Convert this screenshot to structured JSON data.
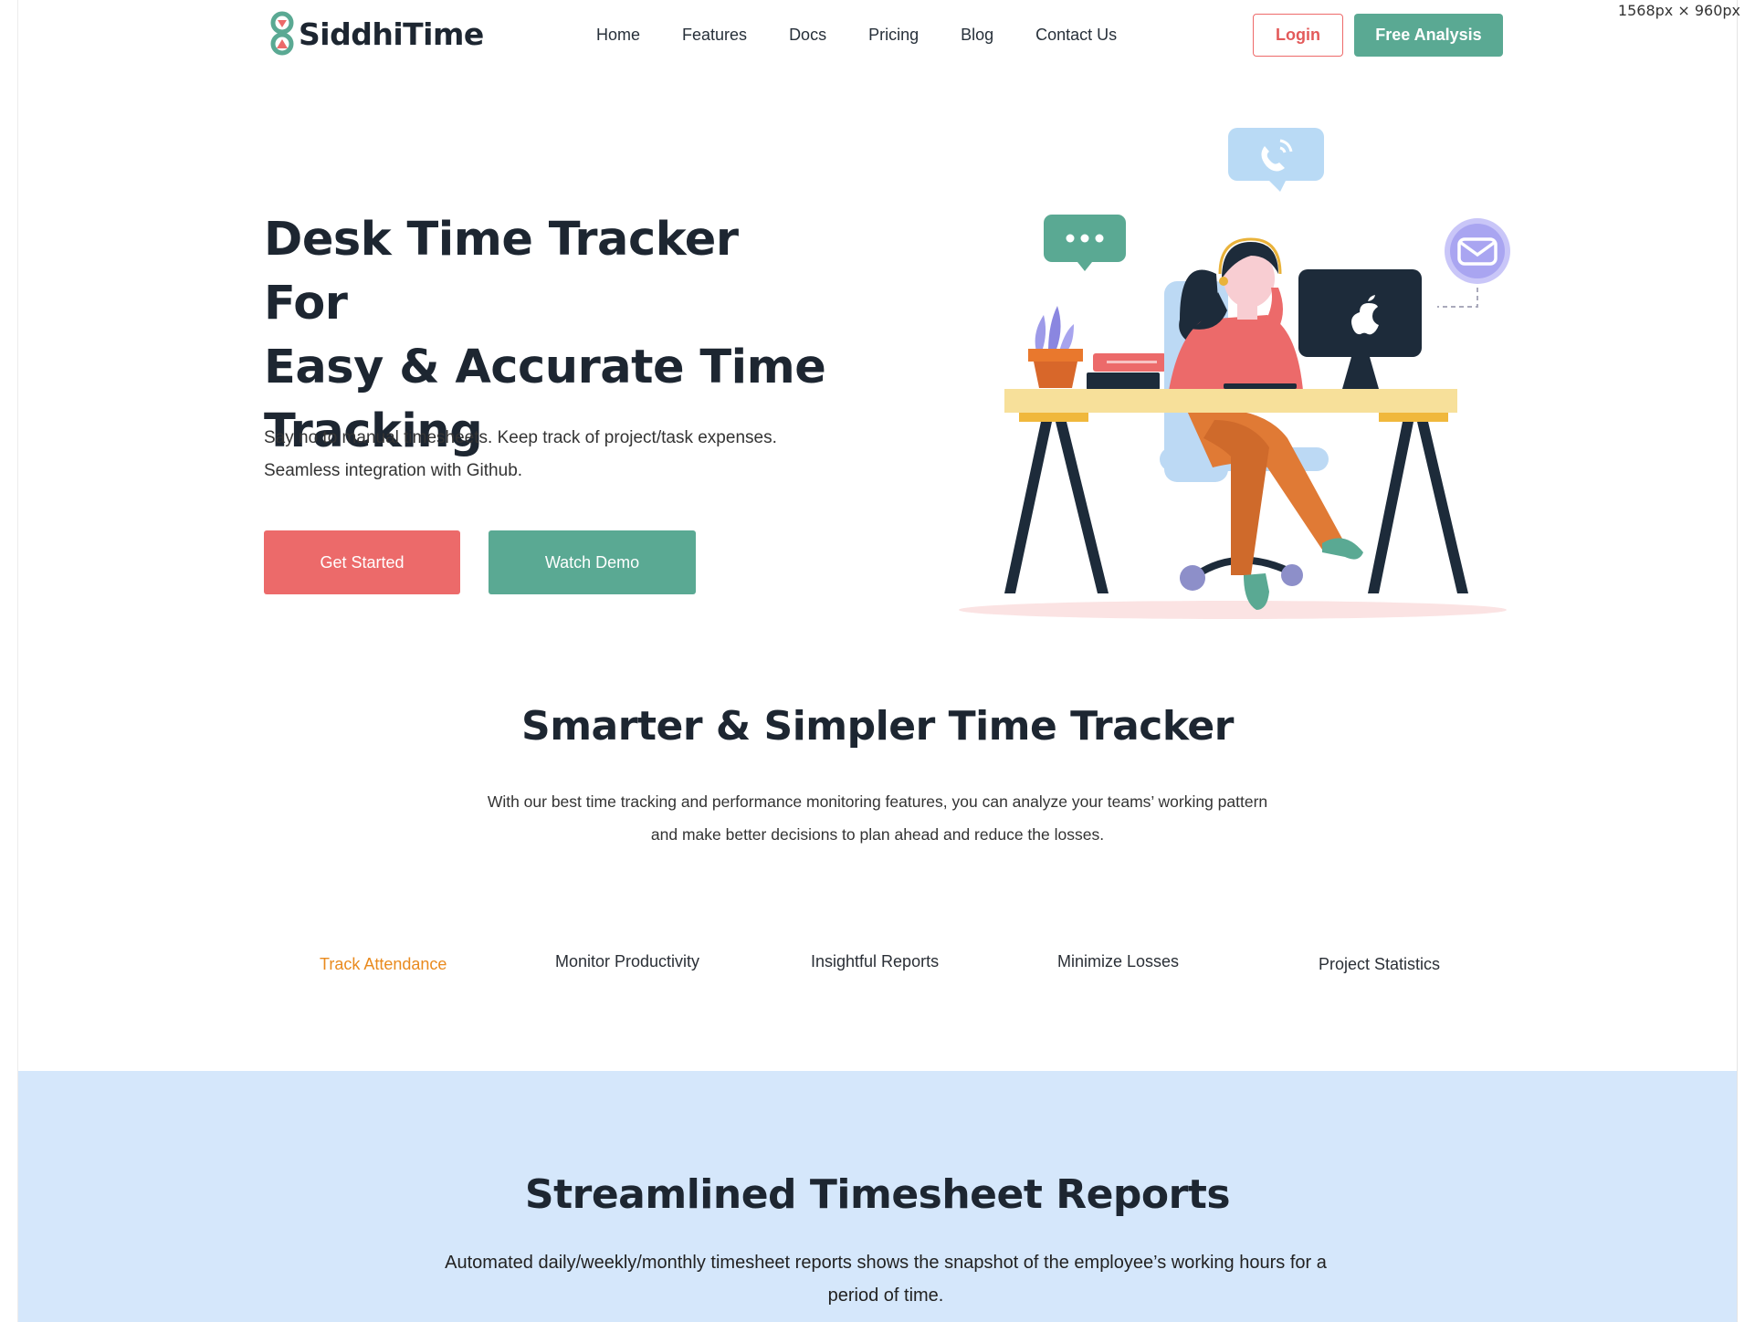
{
  "viewport_label": "1568px × 960px",
  "brand": {
    "name": "SiddhiTime"
  },
  "nav": {
    "items": [
      "Home",
      "Features",
      "Docs",
      "Pricing",
      "Blog",
      "Contact Us"
    ]
  },
  "header": {
    "login_label": "Login",
    "free_analysis_label": "Free Analysis"
  },
  "hero": {
    "title_line1": "Desk Time Tracker For",
    "title_line2": "Easy & Accurate Time",
    "title_line3": "Tracking",
    "subtitle_line1": "Say no to manual timesheets. Keep track of project/task expenses.",
    "subtitle_line2": "Seamless integration with Github.",
    "get_started_label": "Get Started",
    "watch_demo_label": "Watch Demo"
  },
  "features": {
    "title": "Smarter & Simpler Time Tracker",
    "subtitle_line1": "With our best time tracking and performance monitoring features, you can analyze your teams’ working pattern",
    "subtitle_line2": "and make better decisions to plan ahead and reduce the losses.",
    "tabs": [
      {
        "label": "Track Attendance",
        "active": true
      },
      {
        "label": "Monitor Productivity",
        "active": false
      },
      {
        "label": "Insightful Reports",
        "active": false
      },
      {
        "label": "Minimize Losses",
        "active": false
      },
      {
        "label": "Project Statistics",
        "active": false
      }
    ]
  },
  "reports": {
    "title": "Streamlined Timesheet Reports",
    "subtitle_line1": "Automated daily/weekly/monthly timesheet reports shows the snapshot of the employee’s working hours for a",
    "subtitle_line2": "period of time."
  },
  "colors": {
    "brand_dark": "#1d2631",
    "accent_red": "#ec6a6a",
    "accent_green": "#5aa993",
    "active_tab": "#e98a1e",
    "reports_bg": "#d5e7fb"
  },
  "icons": [
    "logo-hourglass-icon",
    "phone-bubble-icon",
    "chat-bubble-icon",
    "mail-icon",
    "apple-icon"
  ]
}
